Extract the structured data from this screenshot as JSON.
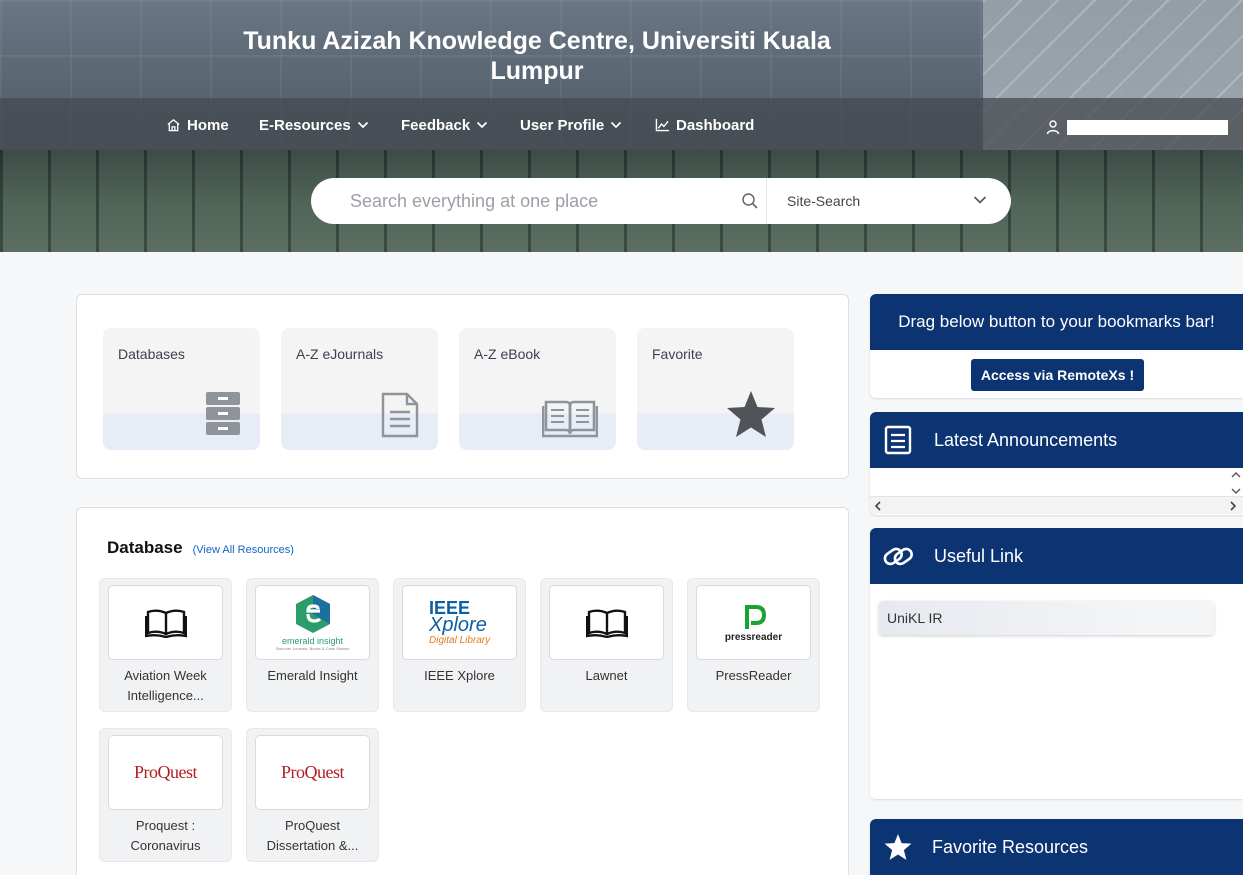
{
  "header": {
    "title": "Tunku Azizah Knowledge Centre, Universiti Kuala Lumpur",
    "nav": [
      {
        "label": "Home",
        "icon": "home-icon"
      },
      {
        "label": "E-Resources",
        "icon": "chevron-down-icon"
      },
      {
        "label": "Feedback",
        "icon": "chevron-down-icon"
      },
      {
        "label": "User Profile",
        "icon": "chevron-down-icon"
      },
      {
        "label": "Dashboard",
        "icon": "chart-line-icon"
      }
    ],
    "user_icon": "user-icon"
  },
  "search": {
    "placeholder": "Search everything at one place",
    "scope": "Site-Search",
    "scope_options": [
      "Site-Search"
    ]
  },
  "quick_links": [
    {
      "label": "Databases",
      "icon": "cabinet-icon"
    },
    {
      "label": "A-Z eJournals",
      "icon": "document-icon"
    },
    {
      "label": "A-Z eBook",
      "icon": "open-book-icon"
    },
    {
      "label": "Favorite",
      "icon": "star-icon"
    }
  ],
  "database": {
    "title": "Database",
    "view_all": "(View All Resources)",
    "items": [
      {
        "name_line1": "Aviation Week",
        "name_line2": "Intelligence...",
        "logo": "book-icon"
      },
      {
        "name_line1": "Emerald Insight",
        "name_line2": "",
        "logo": "emerald-insight-logo",
        "logo_text": "emerald insight",
        "logo_sub": "Discover Journals, Books & Case Studies"
      },
      {
        "name_line1": "IEEE Xplore",
        "name_line2": "",
        "logo": "ieee-xplore-logo",
        "logo_text1": "IEEE",
        "logo_text2": "Xplore",
        "logo_text3": "Digital Library"
      },
      {
        "name_line1": "Lawnet",
        "name_line2": "",
        "logo": "book-icon"
      },
      {
        "name_line1": "PressReader",
        "name_line2": "",
        "logo": "pressreader-logo",
        "logo_text": "pressreader"
      },
      {
        "name_line1": "Proquest :",
        "name_line2": "Coronavirus",
        "logo": "proquest-logo",
        "logo_text": "ProQuest"
      },
      {
        "name_line1": "ProQuest",
        "name_line2": "Dissertation &...",
        "logo": "proquest-logo",
        "logo_text": "ProQuest"
      }
    ]
  },
  "sidebar": {
    "bookmark": {
      "title": "Drag below button to your bookmarks bar!",
      "button": "Access via RemoteXs !"
    },
    "announcements": {
      "title": "Latest Announcements",
      "icon": "announcement-icon"
    },
    "useful_link": {
      "title": "Useful Link",
      "icon": "link-icon",
      "items": [
        "UniKL IR"
      ]
    },
    "favorites": {
      "title": "Favorite Resources",
      "icon": "star-icon"
    }
  },
  "colors": {
    "brand": "#0d3472",
    "link": "#1565c0",
    "tile_bg": "#f4f4f5"
  }
}
